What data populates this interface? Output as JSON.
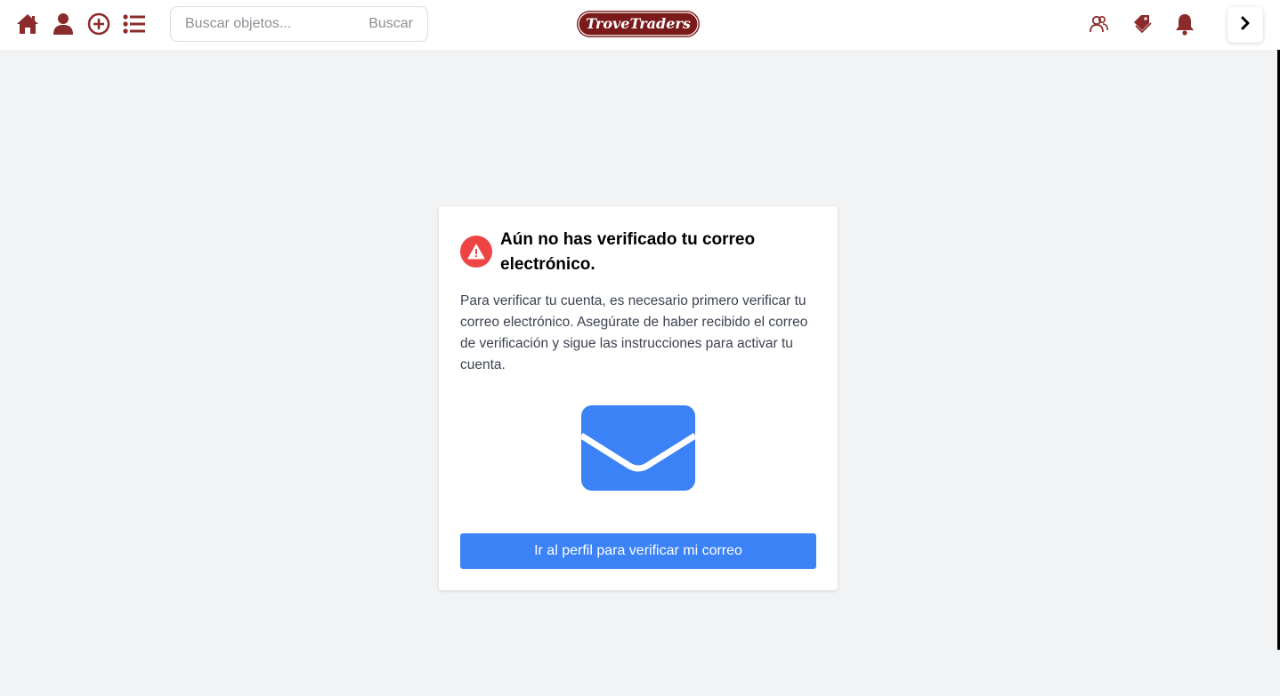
{
  "header": {
    "nav_icons": [
      "home-icon",
      "user-icon",
      "add-circle-icon",
      "list-icon"
    ],
    "search": {
      "placeholder": "Buscar objetos...",
      "value": "",
      "button_label": "Buscar"
    },
    "logo_text": "TroveTraders",
    "right_icons": [
      "people-icon",
      "tags-icon",
      "bell-icon"
    ],
    "collapse_icon": "chevron-right-icon"
  },
  "notice": {
    "icon": "warning-icon",
    "title": "Aún no has verificado tu correo electrónico.",
    "body": "Para verificar tu cuenta, es necesario primero verificar tu correo electrónico. Asegúrate de haber recibido el correo de verificación y sigue las instrucciones para activar tu cuenta.",
    "illustration": "envelope-icon",
    "button_label": "Ir al perfil para verificar mi correo"
  },
  "colors": {
    "brand": "#8b2b2b",
    "accent": "#3b82f6",
    "warning": "#ef4444",
    "background": "#f2f3f5"
  }
}
